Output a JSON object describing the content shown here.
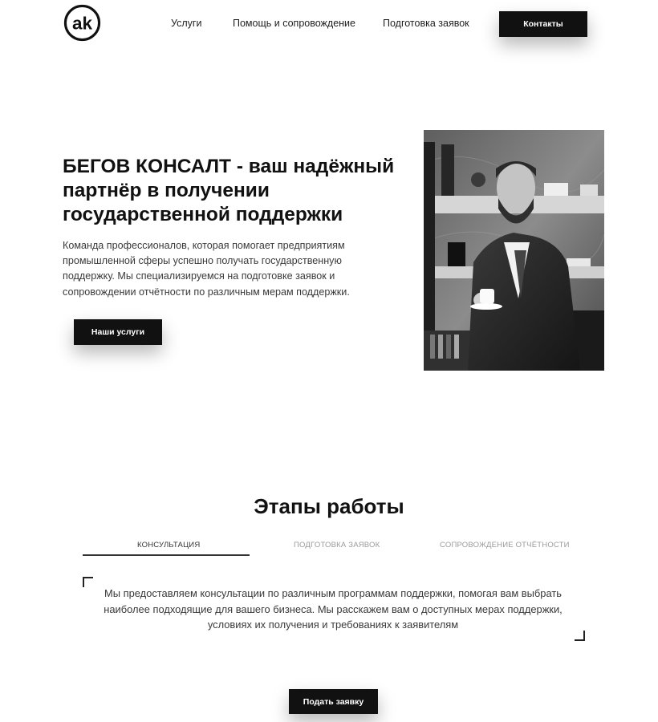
{
  "header": {
    "logo_text": "ak",
    "nav": [
      {
        "label": "Услуги"
      },
      {
        "label": "Помощь и сопровождение"
      },
      {
        "label": "Подготовка заявок"
      }
    ],
    "contacts_label": "Контакты"
  },
  "hero": {
    "title": "БЕГОВ КОНСАЛТ - ваш надёжный партнёр в получении государственной поддержки",
    "description": "Команда профессионалов, которая помогает предприятиям промышленной сферы успешно получать государственную поддержку. Мы специализируемся на подготовке заявок и сопровождении отчётности по различным мерам поддержки.",
    "cta_label": "Наши услуги"
  },
  "stages": {
    "title": "Этапы работы",
    "tabs": [
      {
        "label": "Консультация",
        "active": true
      },
      {
        "label": "Подготовка заявок",
        "active": false
      },
      {
        "label": "Сопровождение отчётности",
        "active": false
      }
    ],
    "active_text": "Мы предоставляем консультации по различным программам поддержки, помогая вам выбрать наиболее подходящие для вашего бизнеса. Мы расскажем вам о доступных мерах поддержки, условиях их получения и требованиях к заявителям",
    "submit_label": "Подать заявку"
  },
  "colors": {
    "accent": "#111111",
    "background": "#ffffff",
    "text": "#1a1a1a",
    "muted_tab": "#9a9a9a"
  }
}
